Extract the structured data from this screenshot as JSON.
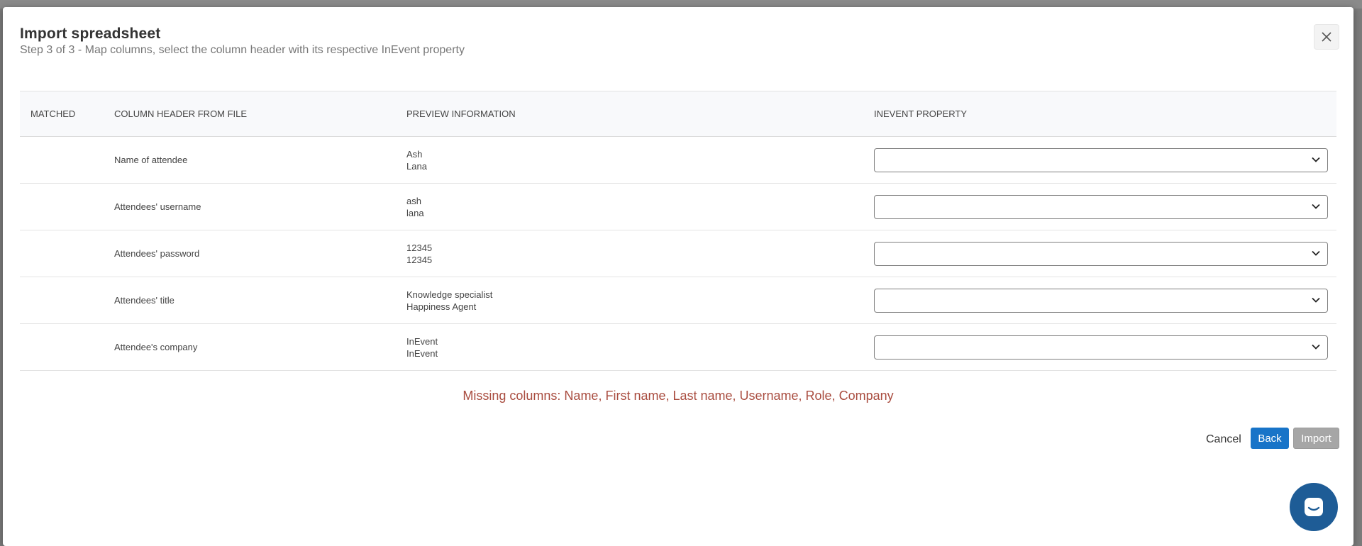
{
  "modal": {
    "title": "Import spreadsheet",
    "subtitle": "Step 3 of 3 - Map columns, select the column header with its respective InEvent property",
    "close_icon": "close-icon"
  },
  "table": {
    "headers": {
      "matched": "MATCHED",
      "column_header": "COLUMN HEADER FROM FILE",
      "preview": "PREVIEW INFORMATION",
      "property": "INEVENT PROPERTY"
    },
    "rows": [
      {
        "matched": "",
        "header": "Name of attendee",
        "preview": [
          "Ash",
          "Lana"
        ],
        "property_value": ""
      },
      {
        "matched": "",
        "header": "Attendees' username",
        "preview": [
          "ash",
          "lana"
        ],
        "property_value": ""
      },
      {
        "matched": "",
        "header": "Attendees' password",
        "preview": [
          "12345",
          "12345"
        ],
        "property_value": ""
      },
      {
        "matched": "",
        "header": "Attendees' title",
        "preview": [
          "Knowledge specialist",
          "Happiness Agent"
        ],
        "property_value": ""
      },
      {
        "matched": "",
        "header": "Attendee's company",
        "preview": [
          "InEvent",
          "InEvent"
        ],
        "property_value": ""
      }
    ]
  },
  "missing_message": "Missing columns: Name, First name, Last name, Username, Role, Company",
  "footer": {
    "cancel_label": "Cancel",
    "back_label": "Back",
    "import_label": "Import"
  },
  "colors": {
    "primary_button": "#1874c8",
    "disabled_button": "#a6a6a6",
    "error_text": "#a94c3f",
    "chat_button": "#1e5c96"
  },
  "chat": {
    "icon": "chat-icon"
  }
}
